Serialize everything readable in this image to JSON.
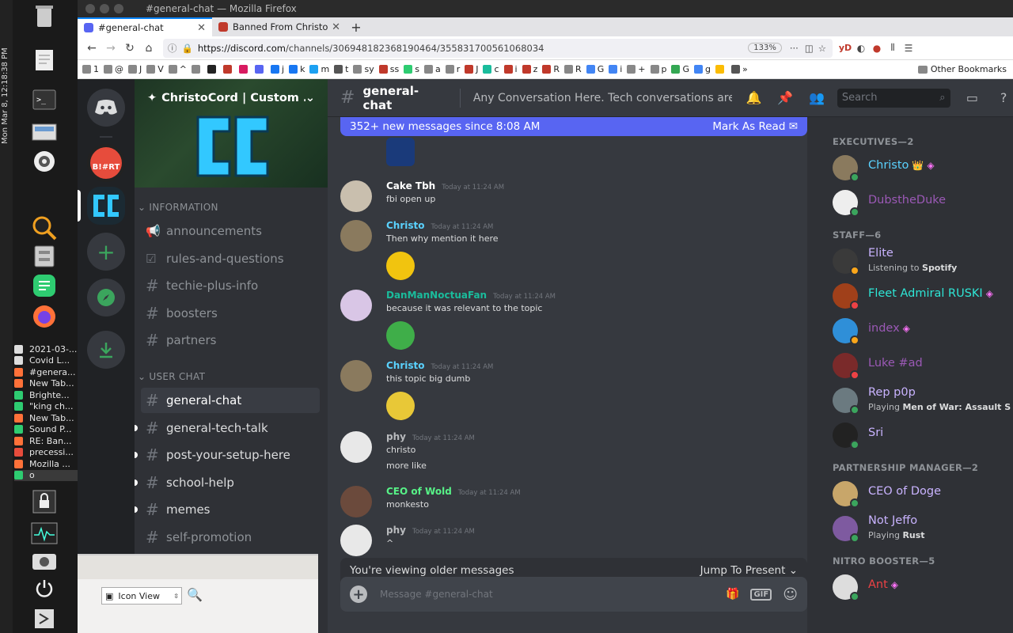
{
  "os": {
    "clock": "Mon Mar 8, 12:18:38 PM",
    "windows": [
      {
        "label": "2021-03-...",
        "color": "#ddd"
      },
      {
        "label": "Covid L...",
        "color": "#ddd"
      },
      {
        "label": "#genera...",
        "color": "#ff7139"
      },
      {
        "label": "New Tab...",
        "color": "#ff7139"
      },
      {
        "label": "Brighte...",
        "color": "#2ecc71"
      },
      {
        "label": "\"king ch...",
        "color": "#2ecc71"
      },
      {
        "label": "New Tab...",
        "color": "#ff7139"
      },
      {
        "label": "Sound P...",
        "color": "#2ecc71"
      },
      {
        "label": "RE: Ban...",
        "color": "#ff7139"
      },
      {
        "label": "precessi...",
        "color": "#e74c3c"
      },
      {
        "label": "Mozilla ...",
        "color": "#ff7139"
      },
      {
        "label": "o",
        "color": "#2ecc71"
      }
    ]
  },
  "firefox": {
    "title": "#general-chat — Mozilla Firefox",
    "tabs": [
      {
        "label": "#general-chat",
        "color": "#5865f2"
      },
      {
        "label": "Banned From ChristoCor",
        "color": "#c0392b"
      }
    ],
    "url_host": "https://discord.com",
    "url_path": "/channels/306948182368190464/355831700561068034",
    "zoom": "133%",
    "ext_label": "yD",
    "bookmarks": [
      "1",
      "@",
      "J",
      "V",
      "^",
      "",
      "",
      "",
      "",
      "",
      "j",
      "k",
      "m",
      "t",
      "sy",
      "ss",
      "s",
      "a",
      "r",
      "J",
      "c",
      "i",
      "z",
      "R",
      "R",
      "G",
      "i",
      "+",
      "p",
      "G",
      "g",
      "",
      "»"
    ],
    "other_bookmarks": "Other Bookmarks"
  },
  "discord": {
    "server_name": "ChristoCord | Custom ...",
    "categories": [
      "INFORMATION",
      "USER CHAT"
    ],
    "channels_info": [
      {
        "name": "announcements",
        "icon": "megaphone-icon"
      },
      {
        "name": "rules-and-questions",
        "icon": "checkbox-icon"
      },
      {
        "name": "techie-plus-info",
        "icon": "hash-icon"
      },
      {
        "name": "boosters",
        "icon": "hash-icon"
      },
      {
        "name": "partners",
        "icon": "hash-icon"
      }
    ],
    "channels_chat": [
      {
        "name": "general-chat",
        "selected": true,
        "unread": false
      },
      {
        "name": "general-tech-talk",
        "selected": false,
        "unread": true
      },
      {
        "name": "post-your-setup-here",
        "selected": false,
        "unread": true
      },
      {
        "name": "school-help",
        "selected": false,
        "unread": true
      },
      {
        "name": "memes",
        "selected": false,
        "unread": true
      },
      {
        "name": "self-promotion",
        "selected": false,
        "unread": false
      }
    ],
    "channel_title": "general-chat",
    "topic": "Any Conversation Here. Tech conversations are all...",
    "search_placeholder": "Search",
    "new_messages": "352+ new messages since 8:08 AM",
    "mark_read": "Mark As Read",
    "messages": [
      {
        "user": "Cake Tbh",
        "color": "#ffffff",
        "time": "Today at 11:24 AM",
        "lines": [
          "fbi open up"
        ],
        "emoji": false,
        "avatar": "#c9bfae"
      },
      {
        "user": "Christo",
        "color": "#5ad2ff",
        "time": "Today at 11:24 AM",
        "lines": [
          "Then why mention it here"
        ],
        "emoji": true,
        "avatar": "#8a7a5e"
      },
      {
        "user": "DanManNoctuaFan",
        "color": "#1abc9c",
        "time": "Today at 11:24 AM",
        "lines": [
          "because it was relevant to the topic"
        ],
        "emoji": true,
        "avatar": "#d9c6e6"
      },
      {
        "user": "Christo",
        "color": "#5ad2ff",
        "time": "Today at 11:24 AM",
        "lines": [
          "this topic big dumb"
        ],
        "emoji": true,
        "avatar": "#8a7a5e"
      },
      {
        "user": "phy",
        "color": "#b9bbbe",
        "time": "Today at 11:24 AM",
        "lines": [
          "christo",
          "more like"
        ],
        "emoji": false,
        "avatar": "#e8e8e8"
      },
      {
        "user": "CEO of Wold",
        "color": "#57f287",
        "time": "Today at 11:24 AM",
        "lines": [
          "monkesto"
        ],
        "emoji": false,
        "avatar": "#6b4a3c"
      },
      {
        "user": "phy",
        "color": "#b9bbbe",
        "time": "Today at 11:24 AM",
        "lines": [
          "^"
        ],
        "emoji": false,
        "avatar": "#e8e8e8"
      }
    ],
    "older_notice": "You're viewing older messages",
    "jump_present": "Jump To Present",
    "composer_placeholder": "Message #general-chat",
    "gif_label": "GIF",
    "member_groups": [
      {
        "title": "EXECUTIVES—2",
        "members": [
          {
            "name": "Christo",
            "color": "#5ad2ff",
            "badge": "crown",
            "sub": "",
            "status": "#3ba55d",
            "avatar": "#8a7a5e"
          },
          {
            "name": "DubstheDuke",
            "color": "#9b59b6",
            "badge": "",
            "sub": "",
            "status": "#3ba55d",
            "avatar": "#eeeeee"
          }
        ]
      },
      {
        "title": "STAFF—6",
        "members": [
          {
            "name": "Elite",
            "color": "#c9b3ff",
            "badge": "",
            "sub_prefix": "Listening to ",
            "sub_bold": "Spotify",
            "status": "#faa61a",
            "avatar": "#3a3a3a"
          },
          {
            "name": "Fleet Admiral RUSKI",
            "color": "#2ee6d6",
            "badge": "gem",
            "sub": "",
            "status": "#ed4245",
            "avatar": "#a0401a"
          },
          {
            "name": "index",
            "color": "#9b59b6",
            "badge": "gem",
            "sub": "",
            "status": "#faa61a",
            "avatar": "#2f8fd8"
          },
          {
            "name": "Luke #ad",
            "color": "#9b59b6",
            "badge": "",
            "sub": "",
            "status": "#ed4245",
            "avatar": "#7a2a2a"
          },
          {
            "name": "Rep p0p",
            "color": "#c9b3ff",
            "badge": "",
            "sub_prefix": "Playing ",
            "sub_bold": "Men of War: Assault S...",
            "status": "#3ba55d",
            "avatar": "#6b7a80"
          },
          {
            "name": "Sri",
            "color": "#c9b3ff",
            "badge": "",
            "sub": "",
            "status": "#3ba55d",
            "avatar": "#222"
          }
        ]
      },
      {
        "title": "PARTNERSHIP MANAGER—2",
        "members": [
          {
            "name": "CEO of Doge",
            "color": "#c9b3ff",
            "badge": "",
            "sub": "",
            "status": "#3ba55d",
            "avatar": "#c8a66a"
          },
          {
            "name": "Not Jeffo",
            "color": "#c9b3ff",
            "badge": "",
            "sub_prefix": "Playing ",
            "sub_bold": "Rust",
            "status": "#3ba55d",
            "avatar": "#7e5aa0"
          }
        ]
      },
      {
        "title": "NITRO BOOSTER—5",
        "members": [
          {
            "name": "Ant",
            "color": "#ed4245",
            "badge": "gem",
            "sub": "",
            "status": "#3ba55d",
            "avatar": "#ddd"
          }
        ]
      }
    ],
    "file_manager_view": "Icon View"
  }
}
